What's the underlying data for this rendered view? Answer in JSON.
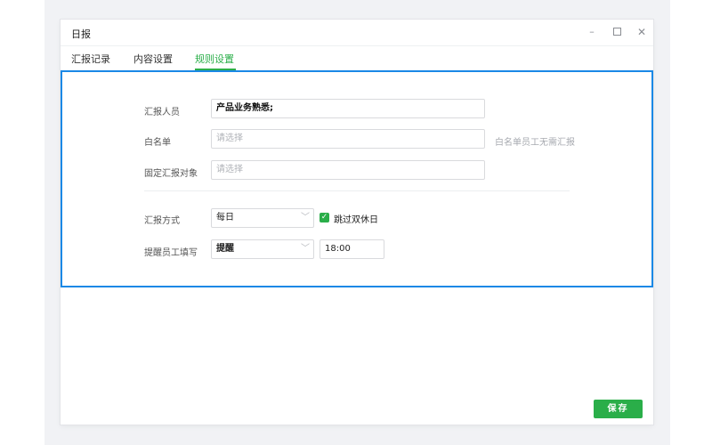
{
  "window": {
    "title": "日报",
    "controls": {
      "minimize": "–",
      "close": "✕"
    }
  },
  "tabs": [
    {
      "label": "汇报记录"
    },
    {
      "label": "内容设置"
    },
    {
      "label": "规则设置",
      "active": true
    }
  ],
  "form": {
    "reporters": {
      "label": "汇报人员",
      "value": "产品业务熟悉;"
    },
    "whitelist": {
      "label": "白名单",
      "placeholder": "请选择",
      "hint": "白名单员工无需汇报"
    },
    "fixed_target": {
      "label": "固定汇报对象",
      "placeholder": "请选择"
    },
    "method": {
      "label": "汇报方式",
      "value": "每日",
      "skip_weekends": {
        "label": "跳过双休日",
        "checked": true
      }
    },
    "reminder": {
      "label": "提醒员工填写",
      "value": "提醒",
      "time": "18:00"
    }
  },
  "actions": {
    "save": "保存"
  },
  "colors": {
    "accent": "#2aae49",
    "highlight_border": "#1a88e6"
  }
}
